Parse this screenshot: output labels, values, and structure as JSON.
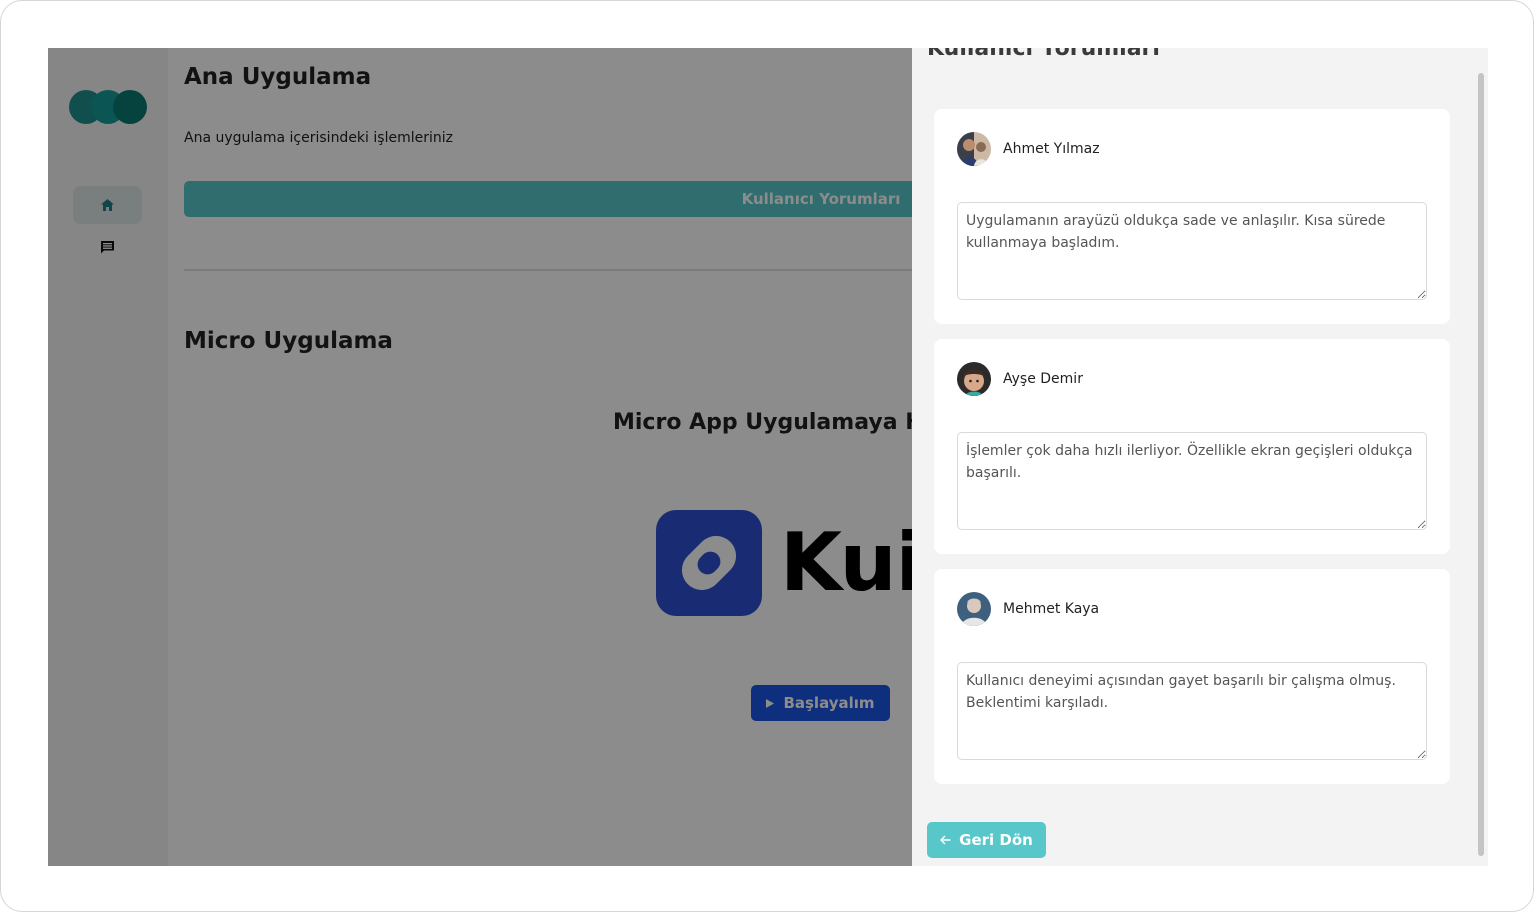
{
  "colors": {
    "accent": "#57c7c9",
    "primary_blue": "#1a55e6",
    "kuika_blue": "#2d4fd2",
    "logo_dots": [
      "#1f8f8f",
      "#179c9c",
      "#0e7a72"
    ]
  },
  "sidebar": {
    "logo": "three-dot-logo",
    "items": [
      {
        "icon": "home-icon",
        "active": true
      },
      {
        "icon": "comment-icon",
        "active": false
      }
    ]
  },
  "main": {
    "title": "Ana Uygulama",
    "description": "Ana uygulama içerisindeki işlemleriniz",
    "comments_button_label": "Kullanıcı Yorumları",
    "micro_section": {
      "title": "Micro Uygulama",
      "heading": "Micro App Uygulamaya Ho",
      "brand_text": "Kuik",
      "start_button_label": "Başlayalım"
    }
  },
  "drawer": {
    "title": "Kullanıcı Yorumları",
    "comments": [
      {
        "name": "Ahmet Yılmaz",
        "text": "Uygulamanın arayüzü oldukça sade ve anlaşılır. Kısa sürede kullanmaya başladım."
      },
      {
        "name": "Ayşe Demir",
        "text": "İşlemler çok daha hızlı ilerliyor. Özellikle ekran geçişleri oldukça başarılı."
      },
      {
        "name": "Mehmet Kaya",
        "text": "Kullanıcı deneyimi açısından gayet başarılı bir çalışma olmuş. Beklentimi karşıladı."
      }
    ],
    "back_button_label": "Geri Dön"
  }
}
